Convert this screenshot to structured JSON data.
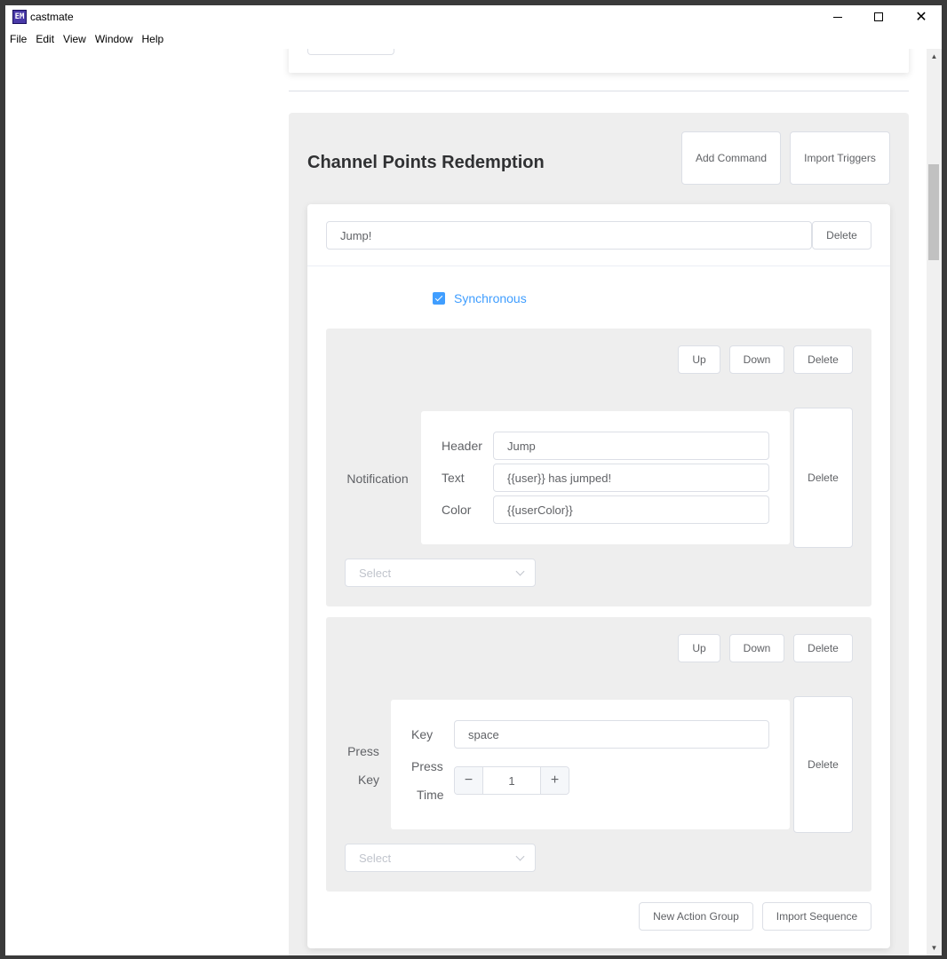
{
  "window": {
    "app_icon_text": "EM",
    "title": "castmate"
  },
  "menu": [
    "File",
    "Edit",
    "View",
    "Window",
    "Help"
  ],
  "trigger": {
    "title": "Channel Points Redemption",
    "add_command_label": "Add Command",
    "import_triggers_label": "Import Triggers"
  },
  "command": {
    "name_value": "Jump!",
    "delete_label": "Delete",
    "synchronous_label": "Synchronous",
    "synchronous_checked": true,
    "new_action_group_label": "New Action Group",
    "import_sequence_label": "Import Sequence"
  },
  "action_groups": [
    {
      "up_label": "Up",
      "down_label": "Down",
      "delete_label": "Delete",
      "action_label": "Notification",
      "action_delete_label": "Delete",
      "fields": [
        {
          "label": "Header",
          "value": "Jump"
        },
        {
          "label": "Text",
          "value": "{{user}} has jumped!"
        },
        {
          "label": "Color",
          "value": "{{userColor}}"
        }
      ],
      "select_placeholder": "Select"
    },
    {
      "up_label": "Up",
      "down_label": "Down",
      "delete_label": "Delete",
      "action_label_line1": "Press",
      "action_label_line2": "Key",
      "action_delete_label": "Delete",
      "key_label": "Key",
      "key_value": "space",
      "press_time_label_line1": "Press",
      "press_time_label_line2": "Time",
      "press_time_value": "1",
      "minus_glyph": "−",
      "plus_glyph": "+",
      "select_placeholder": "Select"
    }
  ],
  "scrollbar": {
    "up_glyph": "▲",
    "down_glyph": "▼"
  }
}
